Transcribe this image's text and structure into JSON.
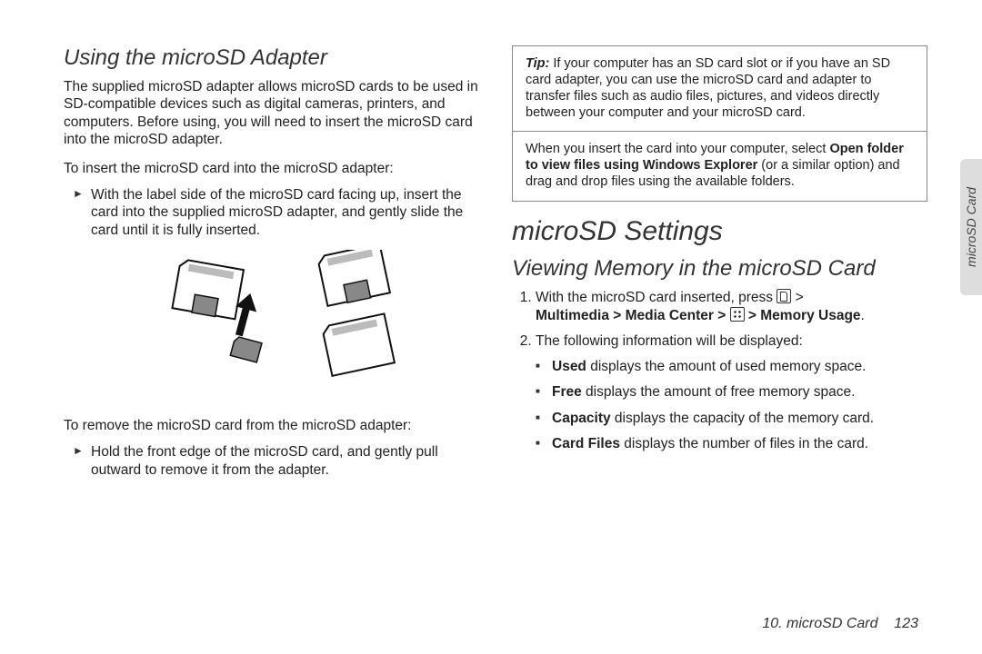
{
  "left": {
    "heading": "Using the microSD Adapter",
    "intro": "The supplied microSD adapter allows microSD cards to be used in SD-compatible devices such as digital cameras, printers, and computers. Before using, you will need to insert the microSD card into the microSD adapter.",
    "insert_lead": "To insert the microSD card into the microSD adapter:",
    "insert_step": "With the label side of the microSD card facing up, insert the card into the supplied microSD adapter, and gently slide the card until it is fully inserted.",
    "remove_lead": "To remove the microSD card from the microSD adapter:",
    "remove_step": "Hold the front edge of the microSD card, and gently pull outward to remove it from the adapter."
  },
  "right": {
    "tip_label": "Tip:",
    "tip_body": "If your computer has an SD card slot or if you have an SD card adapter, you can use the microSD card and adapter to transfer files such as audio files, pictures, and videos directly between your computer and your microSD card.",
    "tip2_lead": "When you insert the card into your computer, select ",
    "tip2_bold": "Open folder to view files using Windows Explorer",
    "tip2_tail": " (or a similar option) and drag and drop files using the available folders.",
    "big_heading": "microSD Settings",
    "sub_heading": "Viewing Memory in the microSD Card",
    "step1_a": "With the microSD card inserted, press ",
    "step1_b": " > ",
    "step1_path1": "Multimedia > Media Center > ",
    "step1_path2": " > Memory Usage",
    "step1_dot": ".",
    "step2": "The following information will be displayed:",
    "mem_used_b": "Used",
    "mem_used": " displays the amount of used memory space.",
    "mem_free_b": "Free",
    "mem_free": " displays the amount of free memory space.",
    "mem_cap_b": "Capacity",
    "mem_cap": " displays the capacity of the memory card.",
    "mem_files_b": "Card Files",
    "mem_files": " displays the number of files in the card."
  },
  "footer": {
    "chapter": "10. microSD Card",
    "page": "123"
  },
  "sidetab": "microSD Card"
}
